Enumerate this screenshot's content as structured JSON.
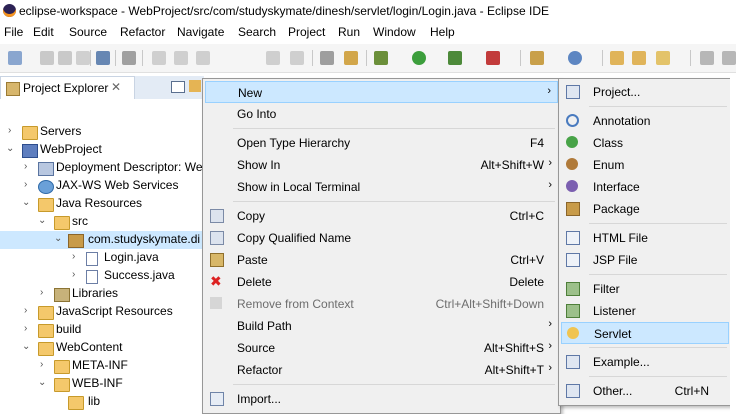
{
  "window": {
    "title": "eclipse-workspace - WebProject/src/com/studyskymate/dinesh/servlet/login/Login.java - Eclipse IDE"
  },
  "menubar": {
    "items": [
      "File",
      "Edit",
      "Source",
      "Refactor",
      "Navigate",
      "Search",
      "Project",
      "Run",
      "Window",
      "Help"
    ]
  },
  "explorer": {
    "tab_label": "Project Explorer",
    "close_glyph": "✕",
    "tree": [
      {
        "label": "Servers",
        "twisty": "›"
      },
      {
        "label": "WebProject",
        "twisty": "⌄"
      },
      {
        "label": "Deployment Descriptor: We",
        "twisty": "›"
      },
      {
        "label": "JAX-WS Web Services",
        "twisty": "›"
      },
      {
        "label": "Java Resources",
        "twisty": "⌄"
      },
      {
        "label": "src",
        "twisty": "⌄"
      },
      {
        "label": "com.studyskymate.di",
        "twisty": "⌄"
      },
      {
        "label": "Login.java",
        "twisty": "›"
      },
      {
        "label": "Success.java",
        "twisty": "›"
      },
      {
        "label": "Libraries",
        "twisty": "›"
      },
      {
        "label": "JavaScript Resources",
        "twisty": "›"
      },
      {
        "label": "build",
        "twisty": "›"
      },
      {
        "label": "WebContent",
        "twisty": "⌄"
      },
      {
        "label": "META-INF",
        "twisty": "›"
      },
      {
        "label": "WEB-INF",
        "twisty": "⌄"
      },
      {
        "label": "lib",
        "twisty": ""
      }
    ]
  },
  "context_menu": {
    "arrow_glyph": "›",
    "items": [
      {
        "label": "New",
        "accel": "",
        "submenu": true
      },
      {
        "label": "Go Into",
        "accel": ""
      },
      {
        "label": "Open Type Hierarchy",
        "accel": "F4"
      },
      {
        "label": "Show In",
        "accel": "Alt+Shift+W",
        "submenu": true
      },
      {
        "label": "Show in Local Terminal",
        "accel": "",
        "submenu": true
      },
      {
        "label": "Copy",
        "accel": "Ctrl+C"
      },
      {
        "label": "Copy Qualified Name",
        "accel": ""
      },
      {
        "label": "Paste",
        "accel": "Ctrl+V"
      },
      {
        "label": "Delete",
        "accel": "Delete"
      },
      {
        "label": "Remove from Context",
        "accel": "Ctrl+Alt+Shift+Down"
      },
      {
        "label": "Build Path",
        "accel": "",
        "submenu": true
      },
      {
        "label": "Source",
        "accel": "Alt+Shift+S",
        "submenu": true
      },
      {
        "label": "Refactor",
        "accel": "Alt+Shift+T",
        "submenu": true
      },
      {
        "label": "Import...",
        "accel": ""
      }
    ]
  },
  "new_submenu": {
    "items": [
      {
        "label": "Project...",
        "accel": ""
      },
      {
        "label": "Annotation",
        "accel": ""
      },
      {
        "label": "Class",
        "accel": ""
      },
      {
        "label": "Enum",
        "accel": ""
      },
      {
        "label": "Interface",
        "accel": ""
      },
      {
        "label": "Package",
        "accel": ""
      },
      {
        "label": "HTML File",
        "accel": ""
      },
      {
        "label": "JSP File",
        "accel": ""
      },
      {
        "label": "Filter",
        "accel": ""
      },
      {
        "label": "Listener",
        "accel": ""
      },
      {
        "label": "Servlet",
        "accel": ""
      },
      {
        "label": "Example...",
        "accel": ""
      },
      {
        "label": "Other...",
        "accel": "Ctrl+N"
      }
    ]
  },
  "colors": {
    "highlight": "#cce8ff",
    "menu_bg": "#f0f0f0",
    "tree_selected": "#cde8ff"
  }
}
